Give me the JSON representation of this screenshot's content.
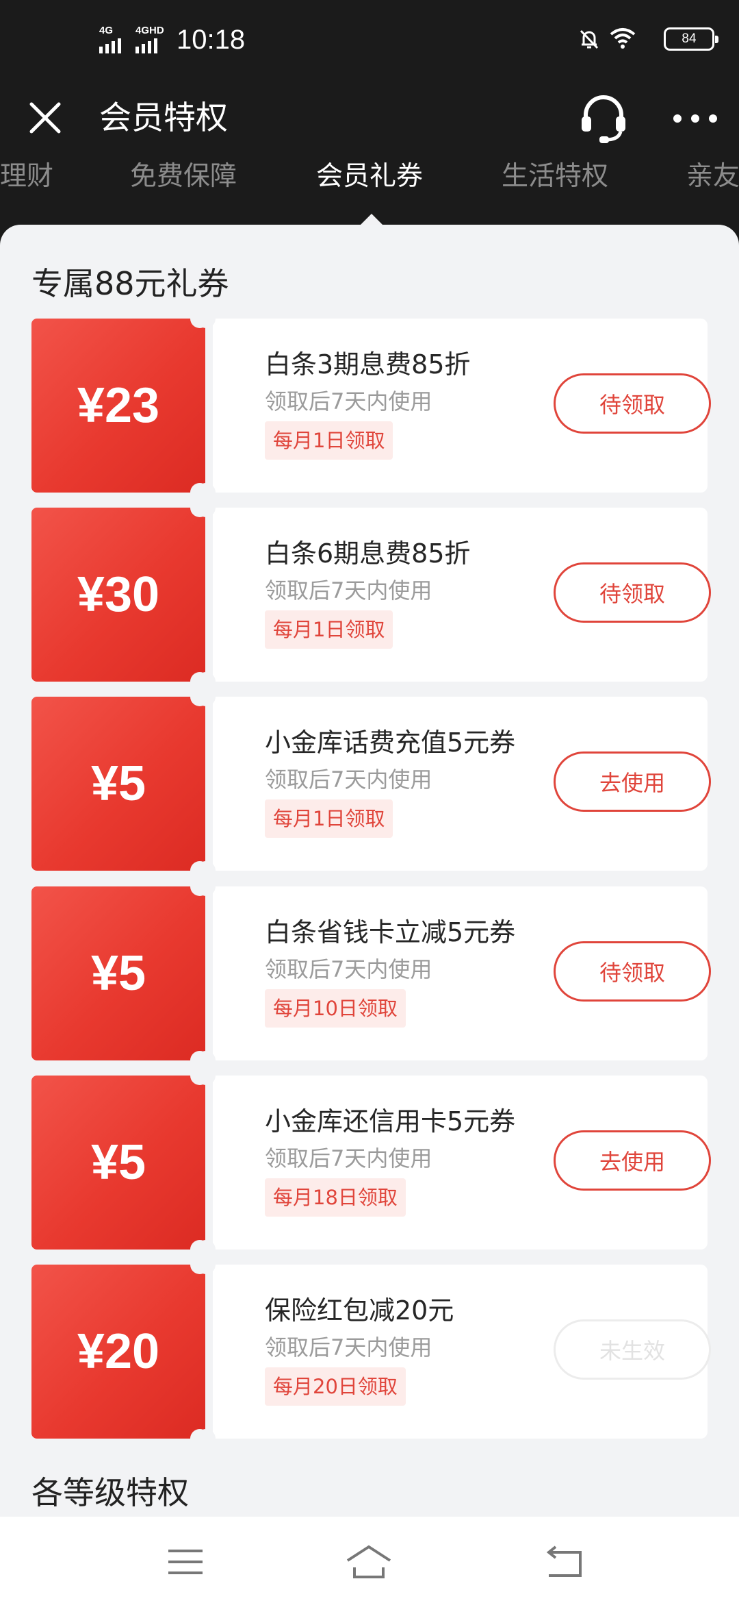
{
  "status_bar": {
    "network1": "4G",
    "network2": "4GHD",
    "time": "10:18",
    "battery": "84",
    "icons": [
      "signal-icon",
      "signal-icon",
      "mute-bell-icon",
      "wifi-icon",
      "battery-icon"
    ]
  },
  "header": {
    "title": "会员特权",
    "icons": [
      "close-icon",
      "headset-icon",
      "more-icon"
    ]
  },
  "tabs": [
    {
      "label": "理财",
      "active": false
    },
    {
      "label": "免费保障",
      "active": false
    },
    {
      "label": "会员礼券",
      "active": true
    },
    {
      "label": "生活特权",
      "active": false
    },
    {
      "label": "亲友",
      "active": false
    }
  ],
  "section": {
    "title": "专属88元礼券",
    "next_title": "各等级特权"
  },
  "coupons": [
    {
      "amount": "¥23",
      "title": "白条3期息费85折",
      "subtitle": "领取后7天内使用",
      "tag": "每月1日领取",
      "button": "待领取",
      "button_enabled": true
    },
    {
      "amount": "¥30",
      "title": "白条6期息费85折",
      "subtitle": "领取后7天内使用",
      "tag": "每月1日领取",
      "button": "待领取",
      "button_enabled": true
    },
    {
      "amount": "¥5",
      "title": "小金库话费充值5元券",
      "subtitle": "领取后7天内使用",
      "tag": "每月1日领取",
      "button": "去使用",
      "button_enabled": true
    },
    {
      "amount": "¥5",
      "title": "白条省钱卡立减5元券",
      "subtitle": "领取后7天内使用",
      "tag": "每月10日领取",
      "button": "待领取",
      "button_enabled": true
    },
    {
      "amount": "¥5",
      "title": "小金库还信用卡5元券",
      "subtitle": "领取后7天内使用",
      "tag": "每月18日领取",
      "button": "去使用",
      "button_enabled": true
    },
    {
      "amount": "¥20",
      "title": "保险红包减20元",
      "subtitle": "领取后7天内使用",
      "tag": "每月20日领取",
      "button": "未生效",
      "button_enabled": false
    }
  ],
  "nav": {
    "icons": [
      "menu-icon",
      "home-icon",
      "back-icon"
    ]
  },
  "colors": {
    "accent": "#e0453b",
    "coupon_red": "#e8392f",
    "header_bg": "#1b1b1b",
    "page_bg": "#f2f3f5"
  }
}
